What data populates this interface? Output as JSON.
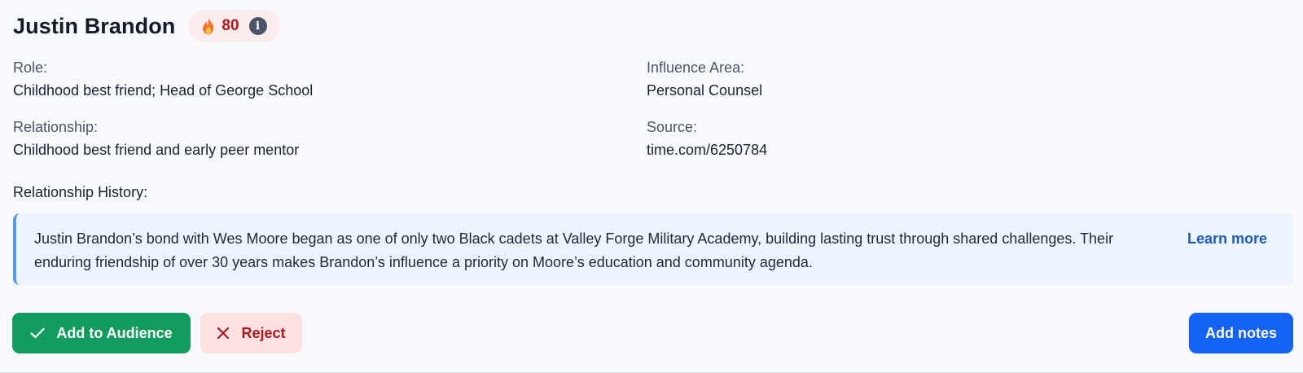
{
  "profile": {
    "name": "Justin Brandon",
    "score": "80",
    "score_icon": "fire-icon",
    "info_icon": "info-icon",
    "info_glyph": "i"
  },
  "fields": {
    "role_label": "Role:",
    "role_value": "Childhood best friend; Head of George School",
    "influence_label": "Influence Area:",
    "influence_value": "Personal Counsel",
    "relationship_label": "Relationship:",
    "relationship_value": "Childhood best friend and early peer mentor",
    "source_label": "Source:",
    "source_value": "time.com/6250784"
  },
  "history": {
    "title": "Relationship History:",
    "text": "Justin Brandon’s bond with Wes Moore began as one of only two Black cadets at Valley Forge Military Academy, building lasting trust through shared challenges. Their enduring friendship of over 30 years makes Brandon’s influence a priority on Moore’s education and community agenda.",
    "learn_more": "Learn more"
  },
  "actions": {
    "add_label": "Add to Audience",
    "add_icon": "check-icon",
    "reject_label": "Reject",
    "reject_icon": "close-icon",
    "notes_label": "Add notes"
  },
  "colors": {
    "background": "#f7f9fc",
    "score_pill_bg": "#fdecec",
    "score_text": "#b3161d",
    "history_bg": "#edf4fd",
    "history_border": "#5a9be6",
    "link": "#1d5bb8",
    "add_button": "#139b5e",
    "reject_button_bg": "#fde1e1",
    "reject_text": "#a81a22",
    "notes_button": "#1362f2"
  }
}
